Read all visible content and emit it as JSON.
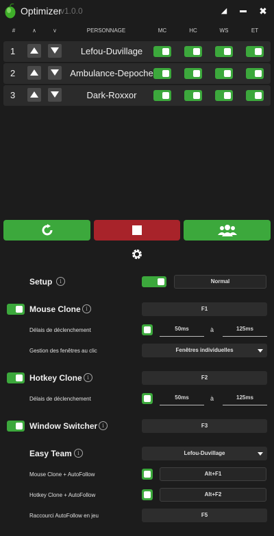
{
  "app": {
    "title": "Optimizer",
    "version": "v1.0.0"
  },
  "window_controls": {
    "pin": "◢",
    "minimize": "▬",
    "close": "✖"
  },
  "table": {
    "headers": {
      "num": "#",
      "up": "∧",
      "down": "v",
      "character": "PERSONNAGE",
      "mc": "MC",
      "hc": "HC",
      "ws": "WS",
      "et": "ET"
    },
    "rows": [
      {
        "num": "1",
        "name": "Lefou-Duvillage",
        "mc": true,
        "hc": true,
        "ws": true,
        "et": true
      },
      {
        "num": "2",
        "name": "Ambulance-Depoche",
        "mc": true,
        "hc": true,
        "ws": true,
        "et": true
      },
      {
        "num": "3",
        "name": "Dark-Roxxor",
        "mc": true,
        "hc": true,
        "ws": true,
        "et": true
      }
    ]
  },
  "actions": {
    "refresh_icon": "refresh-icon",
    "stop_icon": "stop-icon",
    "team_icon": "users-icon",
    "settings_icon": "gear-icon"
  },
  "colors": {
    "green": "#3ca83c",
    "red": "#a8232a",
    "background": "#1c1c1c"
  },
  "settings": {
    "setup": {
      "label": "Setup",
      "info": "i",
      "enabled": true,
      "mode": "Normal"
    },
    "mouse_clone": {
      "label": "Mouse Clone",
      "info": "i",
      "enabled": true,
      "hotkey": "F1",
      "delay_label": "Délais de déclenchement",
      "delay_enabled": true,
      "delay_min": "50ms",
      "delay_sep": "à",
      "delay_max": "125ms",
      "window_mgmt_label": "Gestion des fenêtres au clic",
      "window_mgmt_value": "Fenêtres individuelles"
    },
    "hotkey_clone": {
      "label": "Hotkey Clone",
      "info": "i",
      "enabled": true,
      "hotkey": "F2",
      "delay_label": "Délais de déclenchement",
      "delay_enabled": true,
      "delay_min": "50ms",
      "delay_sep": "à",
      "delay_max": "125ms"
    },
    "window_switcher": {
      "label": "Window Switcher",
      "info": "i",
      "enabled": true,
      "hotkey": "F3"
    },
    "easy_team": {
      "label": "Easy Team",
      "info": "i",
      "leader": "Lefou-Duvillage",
      "mouse_af_label": "Mouse Clone + AutoFollow",
      "mouse_af_enabled": true,
      "mouse_af_hotkey": "Alt+F1",
      "hotkey_af_label": "Hotkey Clone + AutoFollow",
      "hotkey_af_enabled": true,
      "hotkey_af_hotkey": "Alt+F2",
      "ingame_af_label": "Raccourci AutoFollow en jeu",
      "ingame_af_hotkey": "F5"
    }
  }
}
